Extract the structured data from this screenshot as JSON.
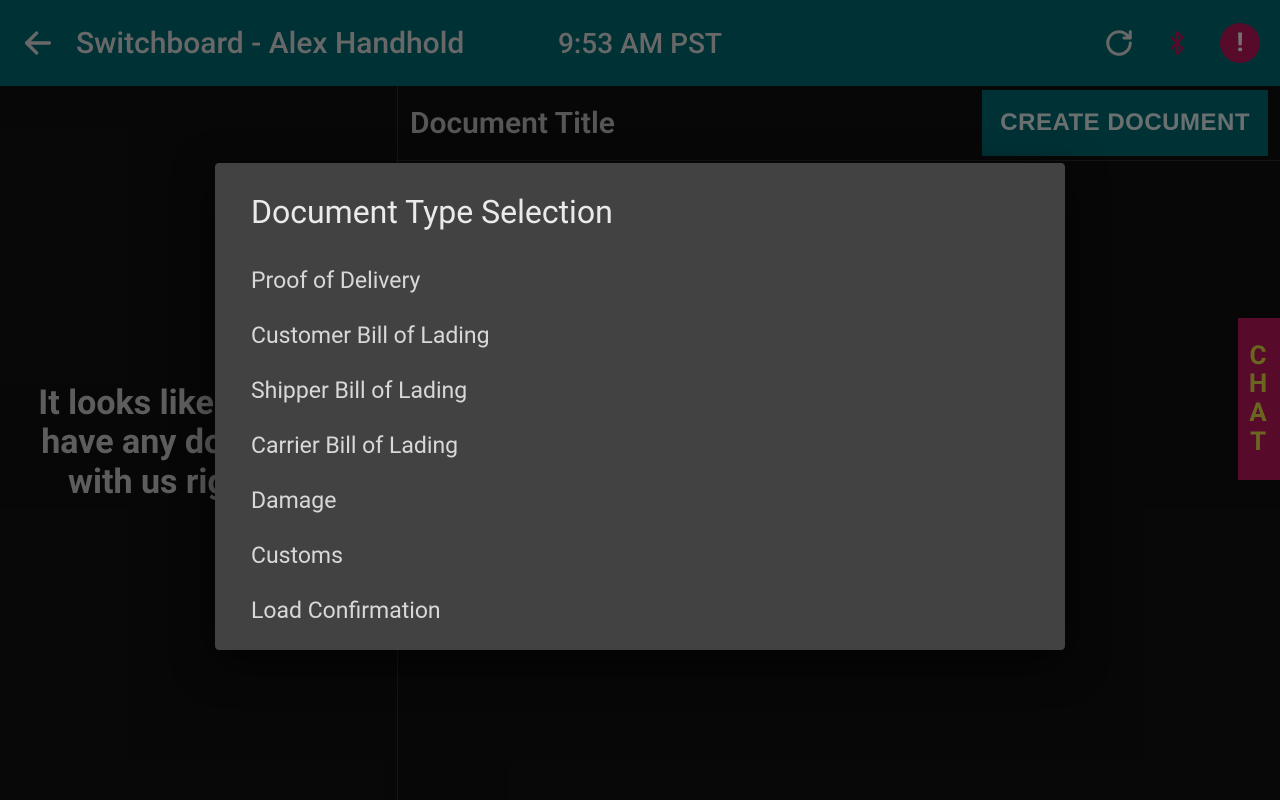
{
  "header": {
    "title": "Switchboard - Alex Handhold",
    "time": "9:53 AM PST",
    "alert_glyph": "!"
  },
  "sidebar": {
    "empty_message": "It looks like you don't have any documents with us right now"
  },
  "content": {
    "doc_title_label": "Document Title",
    "create_button": "CREATE DOCUMENT"
  },
  "chat_tab": {
    "letters": [
      "C",
      "H",
      "A",
      "T"
    ]
  },
  "dialog": {
    "title": "Document Type Selection",
    "items": [
      "Proof of Delivery",
      "Customer Bill of Lading",
      "Shipper Bill of Lading",
      "Carrier Bill of Lading",
      "Damage",
      "Customs",
      "Load Confirmation"
    ]
  },
  "colors": {
    "accent_teal": "#006d77",
    "accent_pink": "#c2185b",
    "chat_text": "#eae149",
    "dialog_bg": "#424242"
  }
}
